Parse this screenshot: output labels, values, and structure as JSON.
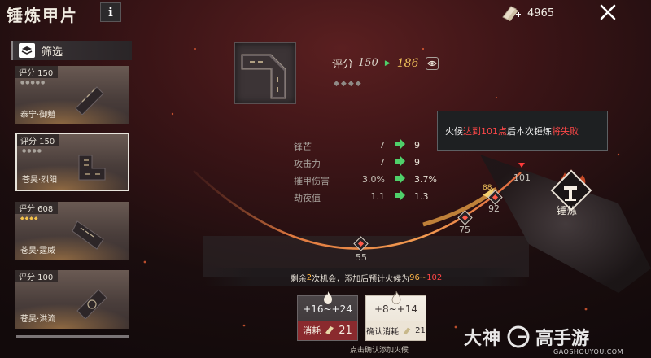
{
  "header": {
    "title": "锤炼甲片",
    "info_label": "i",
    "currency_value": "4965"
  },
  "filter": {
    "label": "筛选"
  },
  "cards": [
    {
      "score": "评分 150",
      "name": "泰宁·御魈",
      "stars": "●●●●●",
      "star_color": "grey",
      "selected": false
    },
    {
      "score": "评分 150",
      "name": "苍昊·烈阳",
      "stars": "●●●●",
      "star_color": "grey",
      "selected": true
    },
    {
      "score": "评分 608",
      "name": "苍昊·霆威",
      "stars": "◆◆◆◆",
      "star_color": "gold",
      "selected": false
    },
    {
      "score": "评分 100",
      "name": "苍昊·洪流",
      "stars": "",
      "star_color": "grey",
      "selected": false
    }
  ],
  "rating": {
    "label": "评分",
    "old": "150",
    "new": "186"
  },
  "top_stars": "◆◆◆◆",
  "tooltip": {
    "prefix": "火候",
    "highlight": "达到101点",
    "middle": "后本次锤炼",
    "failure": "将失败"
  },
  "stats": [
    {
      "label": "锋芒",
      "before": "7",
      "after": "9"
    },
    {
      "label": "攻击力",
      "before": "7",
      "after": "9"
    },
    {
      "label": "摧甲伤害",
      "before": "3.0%",
      "after": "3.7%"
    },
    {
      "label": "劫夜值",
      "before": "1.1",
      "after": "1.3"
    }
  ],
  "gauge": {
    "markers": [
      {
        "value": "55"
      },
      {
        "value": "75"
      },
      {
        "value": "92"
      },
      {
        "value": "88"
      },
      {
        "value": "101"
      }
    ],
    "fail_threshold": 101
  },
  "forge_button": {
    "label": "锤炼"
  },
  "banner": {
    "prefix": "剩余",
    "chances": "2",
    "middle": "次机会，添加后预计火候为",
    "range_low": "96~",
    "range_high": "102"
  },
  "options": [
    {
      "range": "+16~+24",
      "cost_label": "消耗",
      "cost_value": "21"
    },
    {
      "range": "+8~+14",
      "cost_label": "确认消耗",
      "cost_value": "21"
    }
  ],
  "confirm_hint": "点击确认添加火候",
  "watermark": {
    "brand_1": "大神",
    "brand_2": "高手游",
    "url": "GAOSHOUYOU.COM"
  },
  "colors": {
    "accent_gold": "#f3c45c",
    "danger_red": "#ff4848",
    "increase_green": "#4fd06a"
  }
}
